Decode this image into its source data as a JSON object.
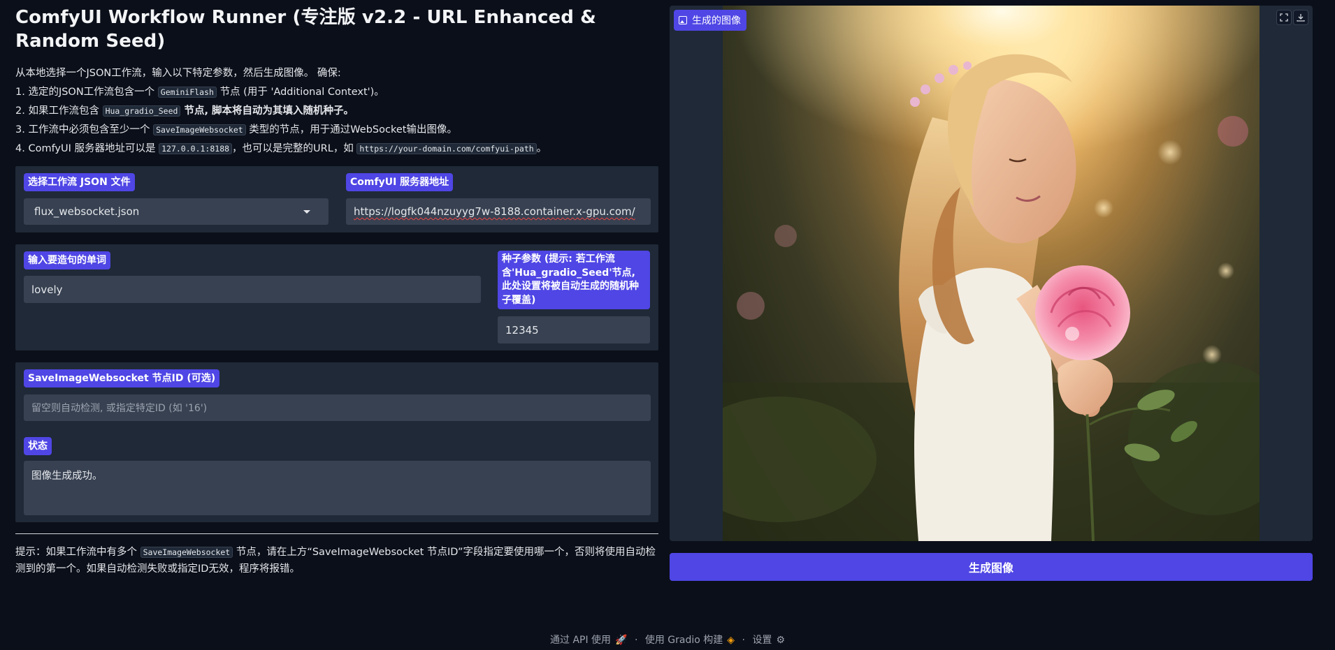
{
  "title": "ComfyUI Workflow Runner (专注版 v2.2 - URL Enhanced & Random Seed)",
  "description": {
    "intro": "从本地选择一个JSON工作流，输入以下特定参数，然后生成图像。 确保:",
    "line1_pre": "1. 选定的JSON工作流包含一个 ",
    "line1_code": "GeminiFlash",
    "line1_post": " 节点 (用于 'Additional Context')。",
    "line2_pre": "2. 如果工作流包含 ",
    "line2_code": "Hua_gradio_Seed",
    "line2_post": " 节点, 脚本将自动为其填入随机种子。",
    "line3_pre": "3. 工作流中必须包含至少一个 ",
    "line3_code": "SaveImageWebsocket",
    "line3_post": " 类型的节点，用于通过WebSocket输出图像。",
    "line4_pre": "4. ComfyUI 服务器地址可以是 ",
    "line4_code1": "127.0.0.1:8188",
    "line4_mid": "，也可以是完整的URL，如 ",
    "line4_code2": "https://your-domain.com/comfyui-path",
    "line4_post": "。"
  },
  "workflow": {
    "label": "选择工作流 JSON 文件",
    "value": "flux_websocket.json"
  },
  "server": {
    "label": "ComfyUI 服务器地址",
    "value": "https://logfk044nzuyyg7w-8188.container.x-gpu.com/"
  },
  "word": {
    "label": "输入要造句的单词",
    "value": "lovely"
  },
  "seed": {
    "label": "种子参数 (提示: 若工作流含'Hua_gradio_Seed'节点, 此处设置将被自动生成的随机种子覆盖)",
    "value": "12345"
  },
  "node_id": {
    "label": "SaveImageWebsocket 节点ID (可选)",
    "placeholder": "留空则自动检测, 或指定特定ID (如 '16')"
  },
  "status": {
    "label": "状态",
    "value": "图像生成成功。"
  },
  "tip": {
    "pre": "提示：如果工作流中有多个 ",
    "code": "SaveImageWebsocket",
    "post": " 节点，请在上方“SaveImageWebsocket 节点ID”字段指定要使用哪一个，否则将使用自动检测到的第一个。如果自动检测失败或指定ID无效，程序将报错。"
  },
  "output": {
    "label": "生成的图像",
    "fullscreen_icon": "fullscreen-icon",
    "download_icon": "download-icon"
  },
  "generate_button": "生成图像",
  "footer": {
    "api": "通过 API 使用",
    "sep": "·",
    "gradio": "使用 Gradio 构建",
    "settings": "设置"
  },
  "colors": {
    "background": "#0b0f19",
    "panel": "#1f2937",
    "input": "#374151",
    "accent": "#4f46e5"
  }
}
